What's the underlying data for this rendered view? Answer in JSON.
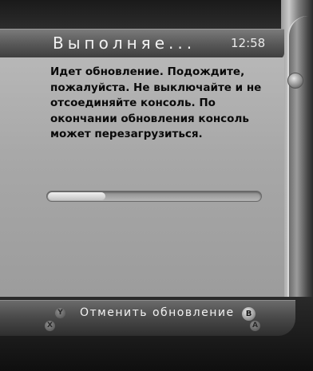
{
  "header": {
    "title": "Выполняе...",
    "clock": "12:58"
  },
  "dialog": {
    "message": "Идет обновление. Подождите, пожалуйста. Не выключайте и не отсоединяйте консоль. По окончании обновления консоль может перезагрузиться.",
    "progress": 0.27
  },
  "footer": {
    "cancel_label": "Отменить обновление",
    "buttons": {
      "y": "Y",
      "x": "X",
      "b": "B",
      "a": "A"
    }
  }
}
